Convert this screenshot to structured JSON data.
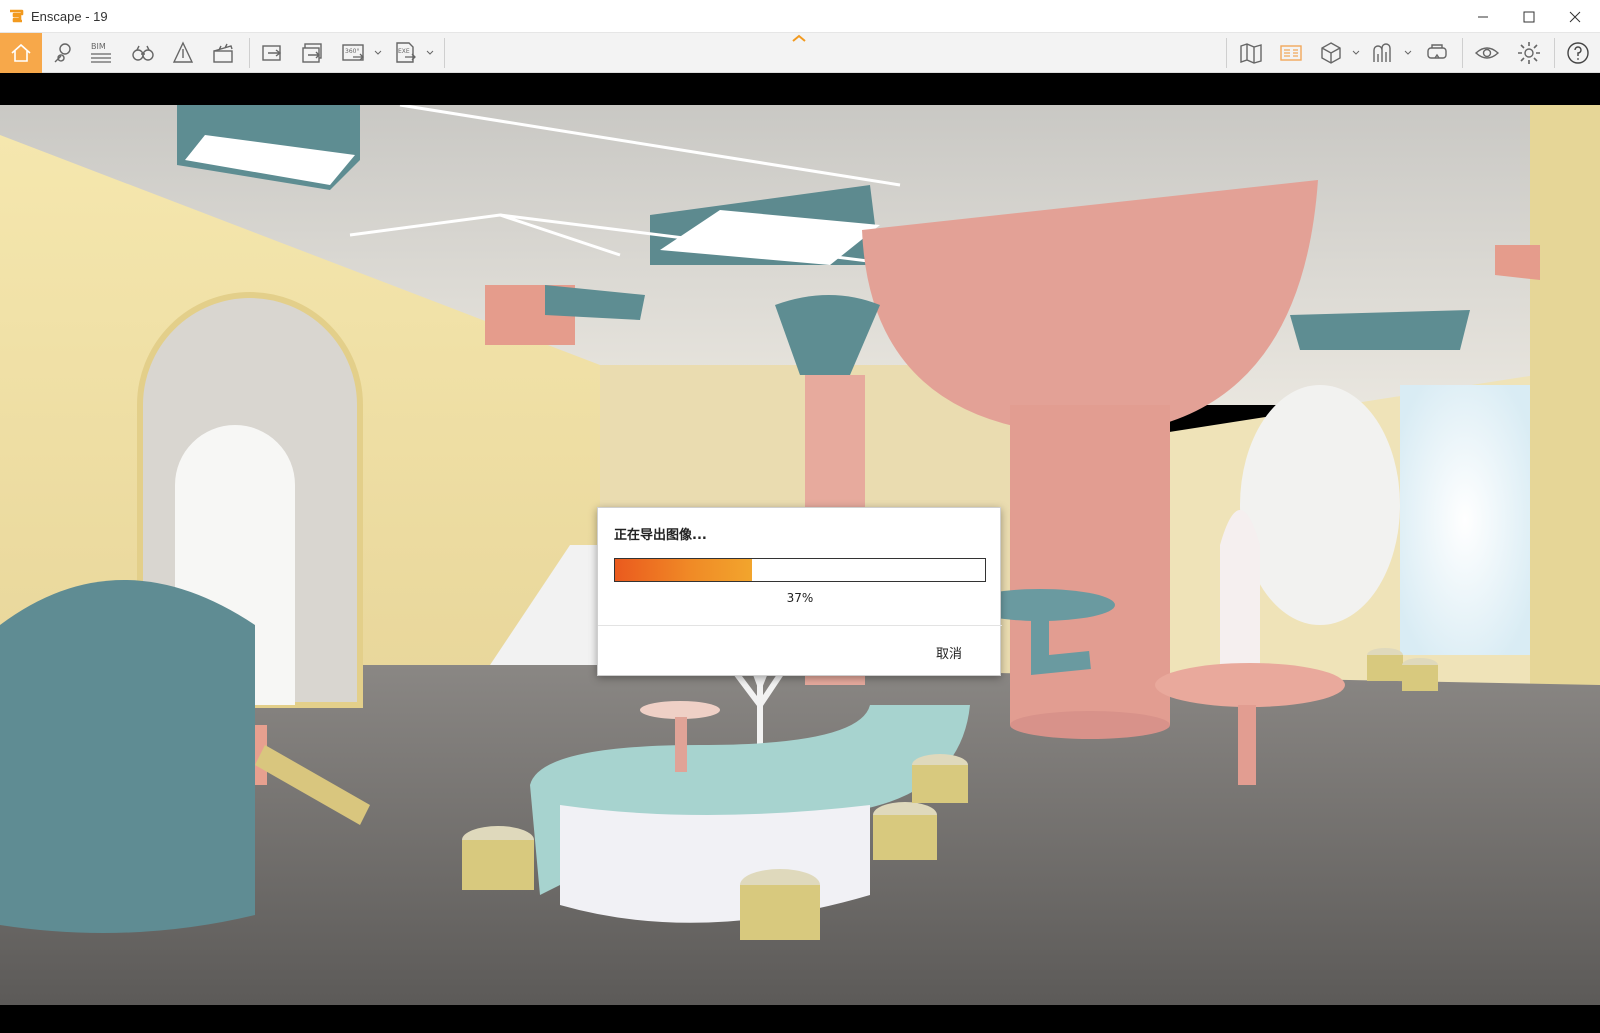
{
  "window": {
    "title": "Enscape - 19"
  },
  "toolbar": {
    "bim_label": "BIM",
    "pano_label": "360°",
    "exe_label": "EXE",
    "left_tools": [
      "home-icon",
      "pin-icon",
      "bim-icon",
      "binoculars-icon",
      "section-icon",
      "clapper-icon",
      "screenshot-icon",
      "batch-render-icon",
      "panorama-icon",
      "exe-export-icon"
    ],
    "right_tools": [
      "map-icon",
      "asset-library-icon",
      "view-cube-icon",
      "material-icon",
      "vr-headset-icon",
      "visual-settings-icon",
      "settings-icon",
      "help-icon"
    ]
  },
  "dialog": {
    "message": "正在导出图像...",
    "progress_fraction": 0.37,
    "progress_text": "37%",
    "cancel_label": "取消"
  },
  "colors": {
    "accent": "#f7a84a",
    "progress_start": "#ea5a1e",
    "progress_end": "#f2a52d",
    "wall": "#efe0a5",
    "pink": "#e3a196",
    "teal": "#5e8f93",
    "floor": "#6d6b69"
  }
}
